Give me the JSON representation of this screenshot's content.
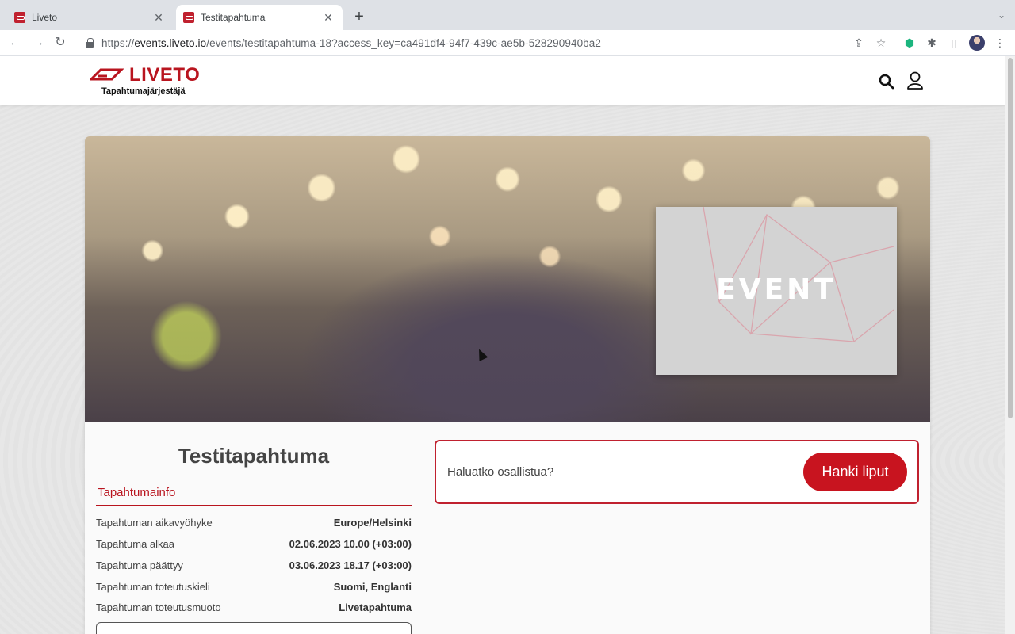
{
  "browser": {
    "tabs": [
      {
        "title": "Liveto",
        "active": false
      },
      {
        "title": "Testitapahtuma",
        "active": true
      }
    ],
    "url_prefix": "https://",
    "url_host": "events.liveto.io",
    "url_path": "/events/testitapahtuma-18?access_key=ca491df4-94f7-439c-ae5b-528290940ba2"
  },
  "header": {
    "logo_text": "LIVETO",
    "logo_subtitle": "Tapahtumajärjestäjä"
  },
  "event": {
    "image_text": "EVENT",
    "title": "Testitapahtuma",
    "info_heading": "Tapahtumainfo",
    "info_rows": [
      {
        "label": "Tapahtuman aikavyöhyke",
        "value": "Europe/Helsinki"
      },
      {
        "label": "Tapahtuma alkaa",
        "value": "02.06.2023 10.00 (+03:00)"
      },
      {
        "label": "Tapahtuma päättyy",
        "value": "03.06.2023 18.17 (+03:00)"
      },
      {
        "label": "Tapahtuman toteutuskieli",
        "value": "Suomi, Englanti"
      },
      {
        "label": "Tapahtuman toteutusmuoto",
        "value": "Livetapahtuma"
      }
    ]
  },
  "cta": {
    "question": "Haluatko osallistua?",
    "button_label": "Hanki liput"
  },
  "colors": {
    "brand_red": "#c8141f",
    "heading_red": "#b9151f"
  }
}
